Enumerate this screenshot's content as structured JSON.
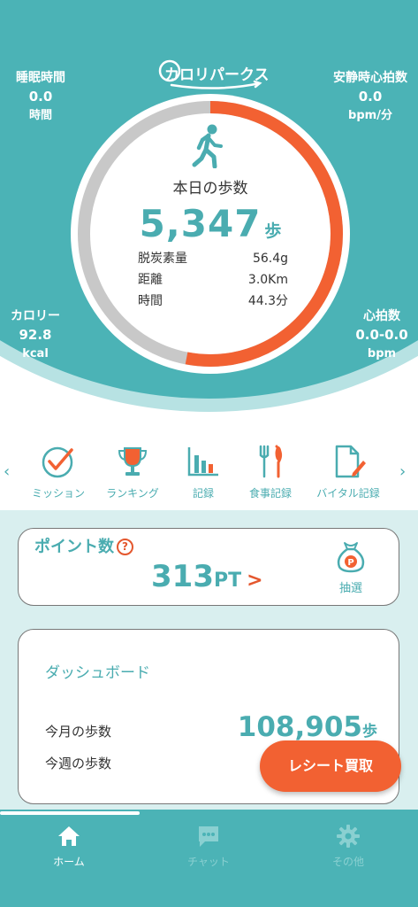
{
  "app": {
    "logo_text": "カロリパークス"
  },
  "colors": {
    "teal": "#4bb3b6",
    "orange": "#f26132",
    "gray_ring": "#c8c8c8"
  },
  "stats": {
    "sleep": {
      "label": "睡眠時間",
      "value": "0.0",
      "unit": "時間"
    },
    "resting_hr": {
      "label": "安静時心拍数",
      "value": "0.0",
      "unit": "bpm/分"
    },
    "calories": {
      "label": "カロリー",
      "value": "92.8",
      "unit": "kcal"
    },
    "heart_rate": {
      "label": "心拍数",
      "value": "0.0-0.0",
      "unit": "bpm"
    }
  },
  "steps": {
    "title": "本日の歩数",
    "value": "5,347",
    "unit": "歩",
    "progress": 0.53,
    "metrics": [
      {
        "label": "脱炭素量",
        "value": "56.4g"
      },
      {
        "label": "距離",
        "value": "3.0Km"
      },
      {
        "label": "時間",
        "value": "44.3分"
      }
    ]
  },
  "menu": {
    "prev": "‹",
    "next": "›",
    "items": [
      {
        "label": "ミッション",
        "icon": "check-circle-icon"
      },
      {
        "label": "ランキング",
        "icon": "trophy-icon"
      },
      {
        "label": "記録",
        "icon": "bar-chart-icon"
      },
      {
        "label": "食事記録",
        "icon": "fork-knife-icon"
      },
      {
        "label": "バイタル記録",
        "icon": "document-pen-icon"
      }
    ]
  },
  "points": {
    "title": "ポイント数",
    "help": "?",
    "value": "313",
    "unit": "PT",
    "arrow": ">",
    "lottery_label": "抽選"
  },
  "dashboard": {
    "title": "ダッシュボード",
    "month_label": "今月の歩数",
    "month_value": "108,905",
    "month_unit": "歩",
    "week_label": "今週の歩数"
  },
  "receipt_button": "レシート買取",
  "tabs": [
    {
      "label": "ホーム",
      "icon": "home-icon",
      "active": true
    },
    {
      "label": "チャット",
      "icon": "chat-icon",
      "active": false
    },
    {
      "label": "その他",
      "icon": "gear-icon",
      "active": false
    }
  ]
}
